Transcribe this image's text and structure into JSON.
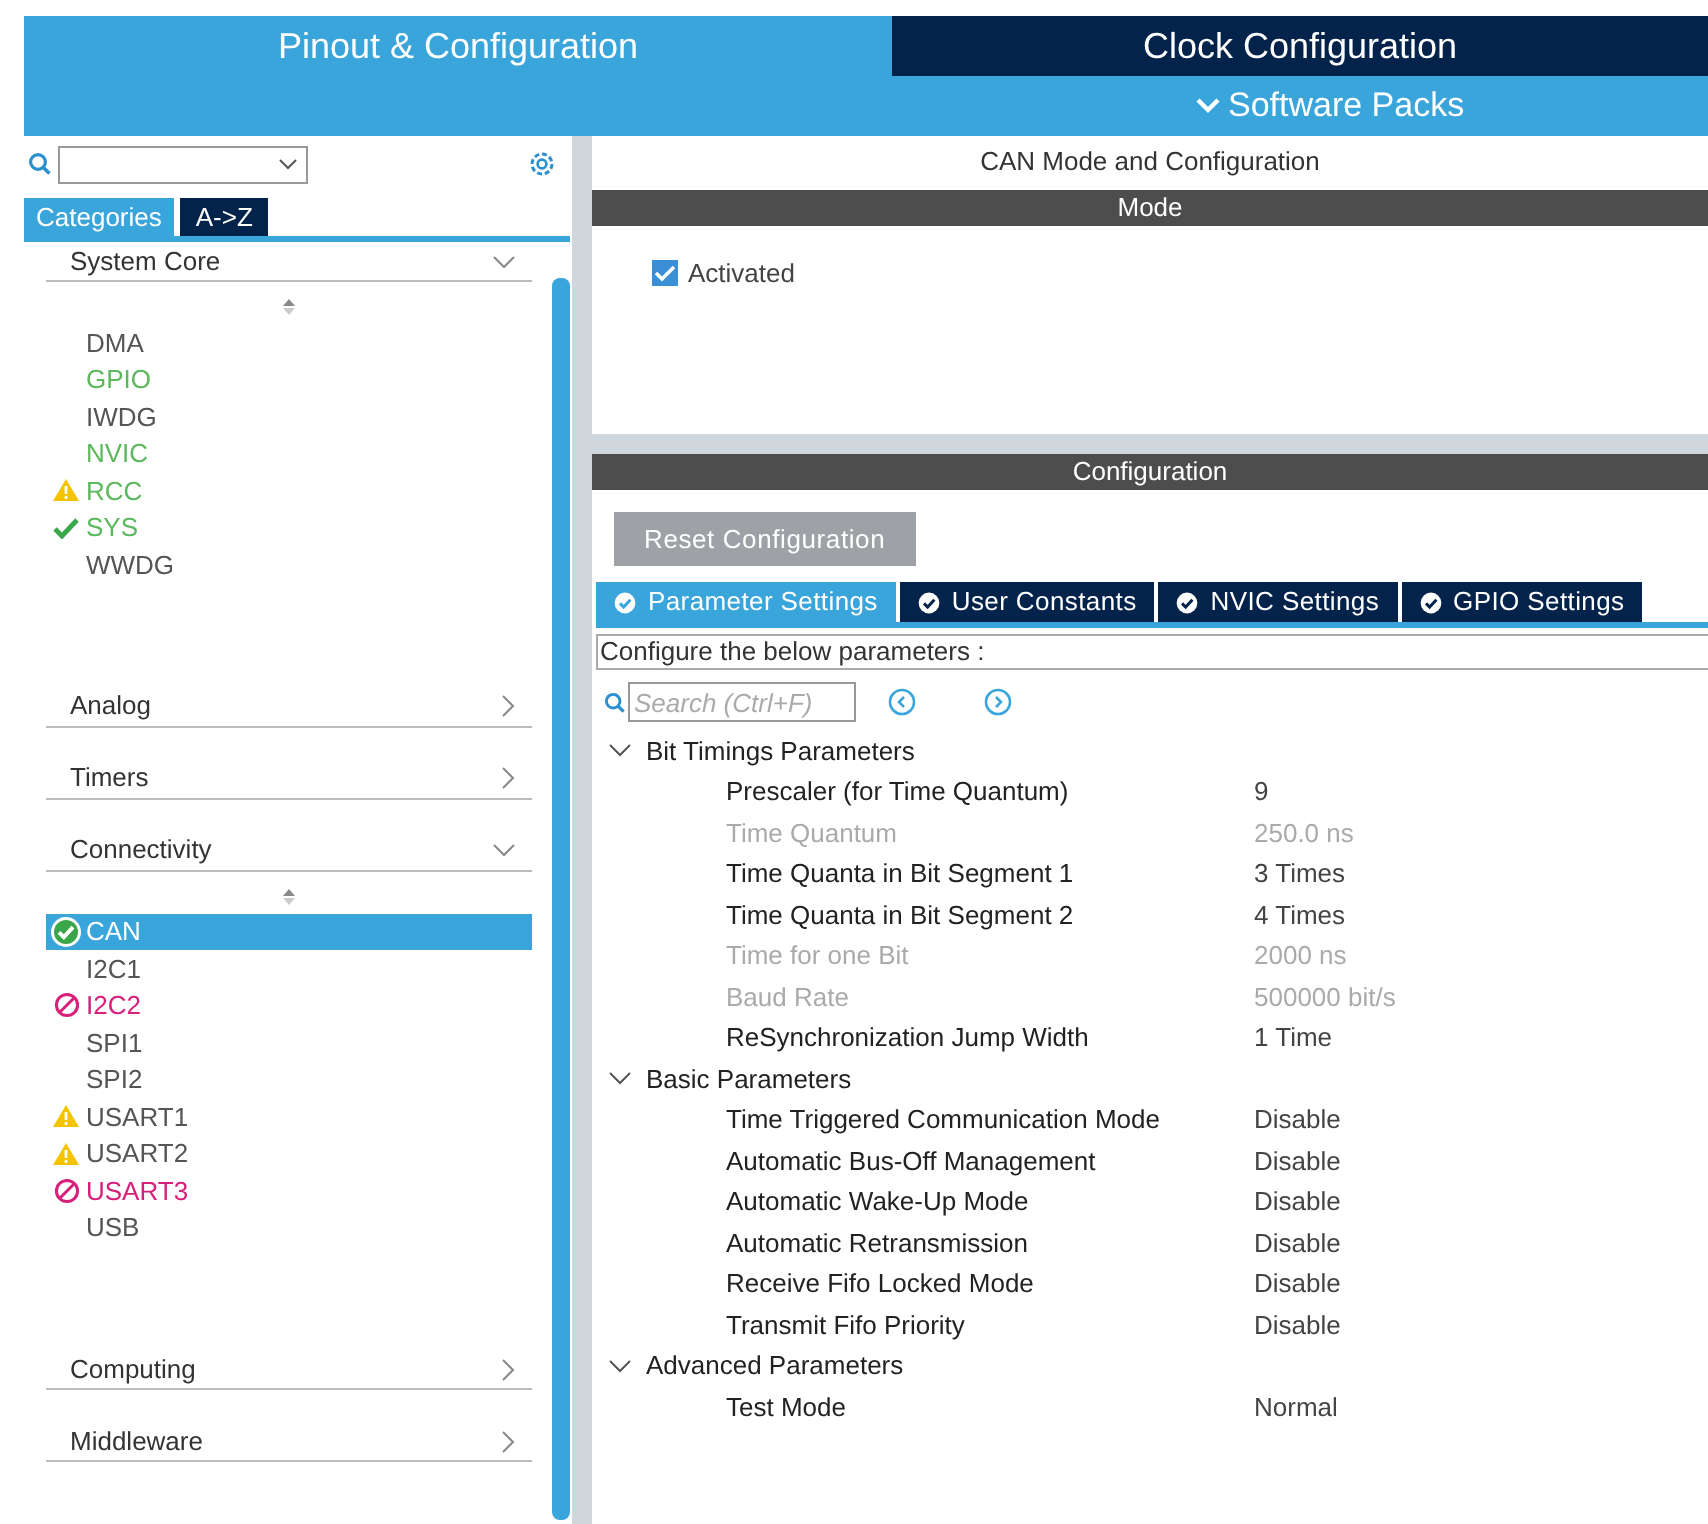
{
  "top_tabs": [
    {
      "label": "Pinout & Configuration",
      "selected": true
    },
    {
      "label": "Clock Configuration",
      "selected": false
    }
  ],
  "software_packs": {
    "label": "Software Packs"
  },
  "sidebar": {
    "tabs": [
      {
        "label": "Categories",
        "selected": true
      },
      {
        "label": "A->Z",
        "selected": false
      }
    ],
    "categories": [
      {
        "label": "System Core",
        "expanded": true,
        "children": [
          {
            "label": "DMA",
            "color": "#555555",
            "kind": "plain",
            "selected": false
          },
          {
            "label": "GPIO",
            "color": "#5cb85c",
            "kind": "plain",
            "selected": false
          },
          {
            "label": "IWDG",
            "color": "#555555",
            "kind": "plain",
            "selected": false
          },
          {
            "label": "NVIC",
            "color": "#5cb85c",
            "kind": "plain",
            "selected": false
          },
          {
            "label": "RCC",
            "color": "#5cb85c",
            "kind": "warning",
            "selected": false
          },
          {
            "label": "SYS",
            "color": "#5cb85c",
            "kind": "ok",
            "selected": false
          },
          {
            "label": "WWDG",
            "color": "#555555",
            "kind": "plain",
            "selected": false
          }
        ]
      },
      {
        "label": "Analog",
        "expanded": false
      },
      {
        "label": "Timers",
        "expanded": false
      },
      {
        "label": "Connectivity",
        "expanded": true,
        "children": [
          {
            "label": "CAN",
            "kind": "ok",
            "selected": true
          },
          {
            "label": "I2C1",
            "color": "#555555",
            "kind": "plain",
            "selected": false
          },
          {
            "label": "I2C2",
            "color": "#d6207a",
            "kind": "blocked",
            "selected": false
          },
          {
            "label": "SPI1",
            "color": "#555555",
            "kind": "plain",
            "selected": false
          },
          {
            "label": "SPI2",
            "color": "#555555",
            "kind": "plain",
            "selected": false
          },
          {
            "label": "USART1",
            "color": "#555555",
            "kind": "warning",
            "selected": false
          },
          {
            "label": "USART2",
            "color": "#555555",
            "kind": "warning",
            "selected": false
          },
          {
            "label": "USART3",
            "color": "#d6207a",
            "kind": "blocked",
            "selected": false
          },
          {
            "label": "USB",
            "color": "#555555",
            "kind": "plain",
            "selected": false
          }
        ]
      },
      {
        "label": "Computing",
        "expanded": false
      },
      {
        "label": "Middleware",
        "expanded": false
      }
    ]
  },
  "panel": {
    "title": "CAN Mode and Configuration",
    "mode_header": "Mode",
    "activated": {
      "label": "Activated",
      "checked": true
    },
    "config_header": "Configuration",
    "reset_button": "Reset Configuration",
    "tabs": [
      {
        "label": "Parameter Settings",
        "selected": true
      },
      {
        "label": "User Constants",
        "selected": false
      },
      {
        "label": "NVIC Settings",
        "selected": false
      },
      {
        "label": "GPIO Settings",
        "selected": false
      }
    ],
    "hint": "Configure the below parameters :",
    "search": {
      "placeholder": "Search (Ctrl+F)"
    },
    "groups": [
      {
        "label": "Bit Timings Parameters",
        "expanded": true,
        "params": [
          {
            "name": "Prescaler (for Time Quantum)",
            "value": "9",
            "disabled": false
          },
          {
            "name": "Time Quantum",
            "value": "250.0 ns",
            "disabled": true
          },
          {
            "name": "Time Quanta in Bit Segment 1",
            "value": "3 Times",
            "disabled": false
          },
          {
            "name": "Time Quanta in Bit Segment 2",
            "value": "4 Times",
            "disabled": false
          },
          {
            "name": "Time for one Bit",
            "value": "2000 ns",
            "disabled": true
          },
          {
            "name": "Baud Rate",
            "value": "500000 bit/s",
            "disabled": true
          },
          {
            "name": "ReSynchronization Jump Width",
            "value": "1 Time",
            "disabled": false
          }
        ]
      },
      {
        "label": "Basic Parameters",
        "expanded": true,
        "params": [
          {
            "name": "Time Triggered Communication Mode",
            "value": "Disable",
            "disabled": false
          },
          {
            "name": "Automatic Bus-Off Management",
            "value": "Disable",
            "disabled": false
          },
          {
            "name": "Automatic Wake-Up Mode",
            "value": "Disable",
            "disabled": false
          },
          {
            "name": "Automatic Retransmission",
            "value": "Disable",
            "disabled": false
          },
          {
            "name": "Receive Fifo Locked Mode",
            "value": "Disable",
            "disabled": false
          },
          {
            "name": "Transmit Fifo Priority",
            "value": "Disable",
            "disabled": false
          }
        ]
      },
      {
        "label": "Advanced Parameters",
        "expanded": true,
        "params": [
          {
            "name": "Test Mode",
            "value": "Normal",
            "disabled": false
          }
        ]
      }
    ]
  }
}
